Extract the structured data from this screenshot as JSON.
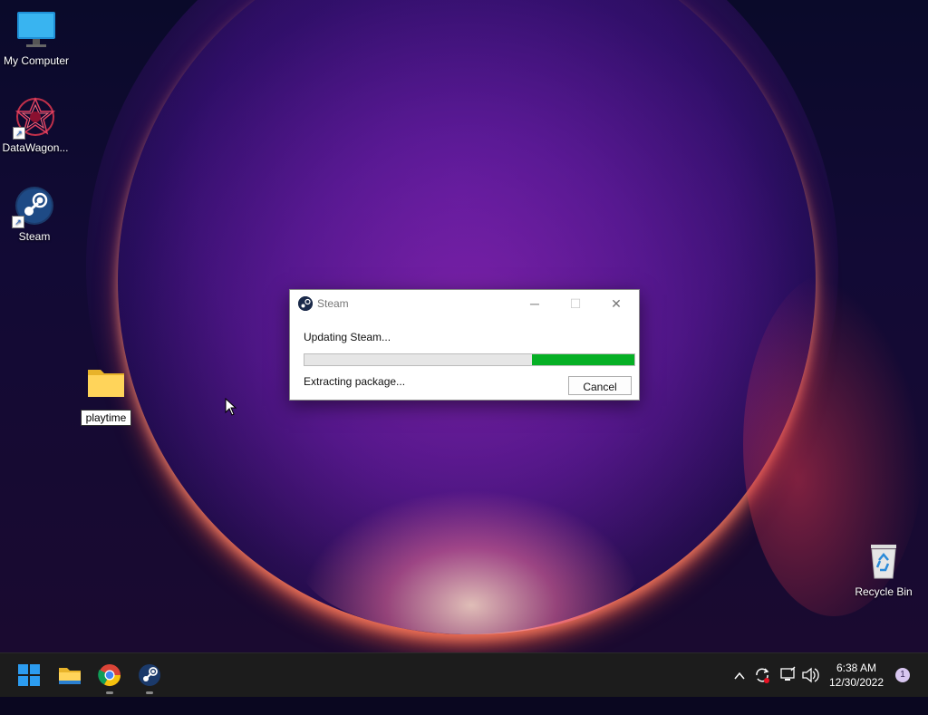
{
  "desktop": {
    "icons": [
      {
        "label": "My Computer"
      },
      {
        "label": "DataWagon..."
      },
      {
        "label": "Steam"
      },
      {
        "label": "playtime"
      },
      {
        "label": "Recycle Bin"
      }
    ]
  },
  "dialog": {
    "title": "Steam",
    "status": "Updating Steam...",
    "detail": "Extracting package...",
    "cancel_label": "Cancel",
    "progress_fraction": 0.31,
    "progress_color": "#06b025"
  },
  "taskbar": {
    "apps": [
      "windows-start-icon",
      "file-explorer-icon",
      "chrome-icon",
      "steam-icon"
    ],
    "tray_icons": [
      "chevron-up-icon",
      "sync-icon",
      "network-icon",
      "volume-icon"
    ],
    "time": "6:38 AM",
    "date": "12/30/2022",
    "notification_count": "1"
  },
  "colors": {
    "accent": "#0078d4",
    "taskbar_bg": "#1c1c1c"
  }
}
